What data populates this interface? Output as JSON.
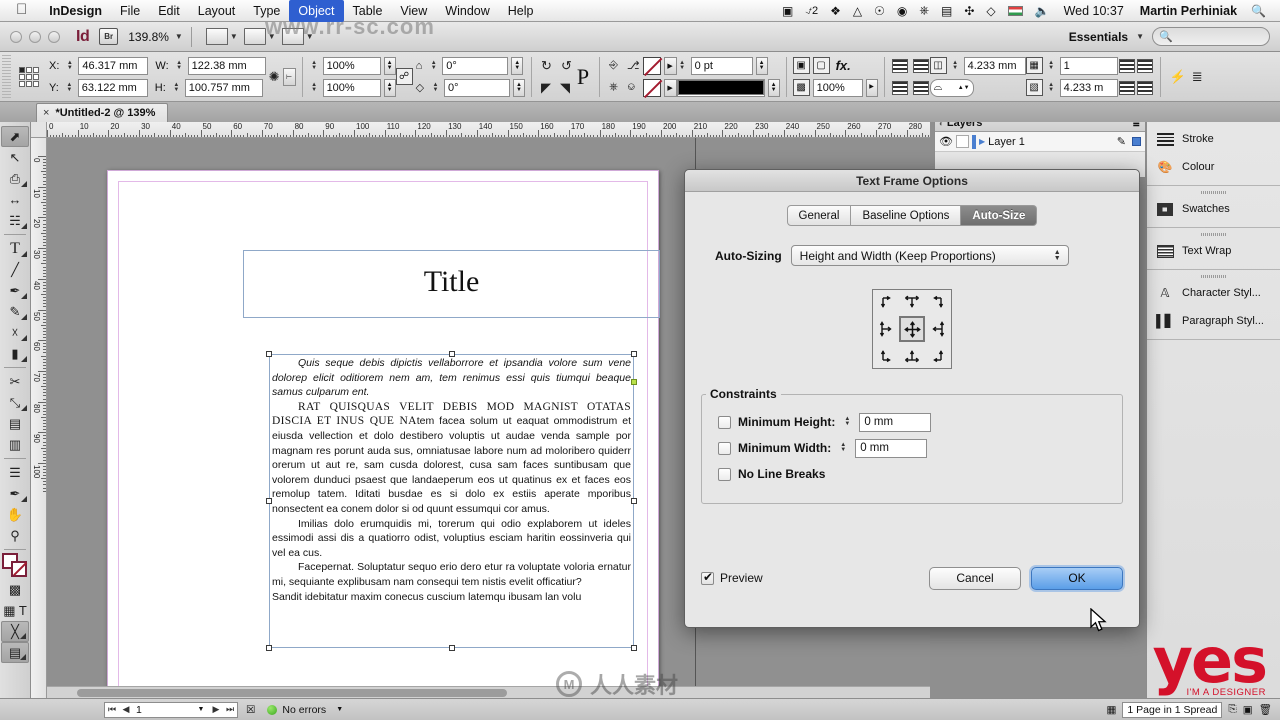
{
  "menubar": {
    "apple_icon": "apple-icon",
    "items": [
      "InDesign",
      "File",
      "Edit",
      "Layout",
      "Type",
      "Object",
      "Table",
      "View",
      "Window",
      "Help"
    ],
    "selected_item": "Object",
    "status_icons": [
      "screen-record-icon",
      "text-expander-icon",
      "dropbox-icon",
      "google-drive-icon",
      "backup-icon",
      "cloud-sync-icon",
      "system-monitor-icon",
      "display-icon",
      "spaces-icon",
      "wifi-icon",
      "flag-icon",
      "volume-icon"
    ],
    "text_expander_count": "2",
    "clock": "Wed 10:37",
    "user": "Martin Perhiniak",
    "search_icon": "spotlight-search-icon"
  },
  "apptitle": {
    "app_logo": "indesign-logo",
    "bridge_label": "Br",
    "zoom_level": "139.8%",
    "workspace": "Essentials",
    "search_placeholder": ""
  },
  "controlbar": {
    "x_label": "X:",
    "x_value": "46.317 mm",
    "y_label": "Y:",
    "y_value": "63.122 mm",
    "w_label": "W:",
    "w_value": "122.38 mm",
    "h_label": "H:",
    "h_value": "100.757 mm",
    "scale_x": "100%",
    "scale_y": "100%",
    "rotation": "0°",
    "shear": "0°",
    "stroke_weight": "0 pt",
    "stroke_type_value": "",
    "opacity": "100%",
    "inset": "4.233 mm",
    "columns": "1",
    "gutter": "4.233 m"
  },
  "tabbar": {
    "document_tab": "*Untitled-2 @ 139%",
    "close_icon": "×"
  },
  "toolbox": {
    "tools": [
      {
        "name": "selection-tool",
        "glyph": "⬈",
        "active": true,
        "flyout": false
      },
      {
        "name": "direct-selection-tool",
        "glyph": "↖",
        "active": false,
        "flyout": false
      },
      {
        "name": "page-tool",
        "glyph": "⬚",
        "active": false,
        "flyout": true
      },
      {
        "name": "gap-tool",
        "glyph": "↔",
        "active": false,
        "flyout": false
      },
      {
        "name": "content-collector-tool",
        "glyph": "☷",
        "active": false,
        "flyout": true
      },
      {
        "name": "type-tool",
        "glyph": "T",
        "active": false,
        "flyout": true
      },
      {
        "name": "line-tool",
        "glyph": "╱",
        "active": false,
        "flyout": false
      },
      {
        "name": "pen-tool",
        "glyph": "✒",
        "active": false,
        "flyout": true
      },
      {
        "name": "pencil-tool",
        "glyph": "✎",
        "active": false,
        "flyout": true
      },
      {
        "name": "frame-tool",
        "glyph": "⌧",
        "active": false,
        "flyout": true
      },
      {
        "name": "rectangle-tool",
        "glyph": "■",
        "active": false,
        "flyout": true
      },
      {
        "name": "scissors-tool",
        "glyph": "✂",
        "active": false,
        "flyout": false
      },
      {
        "name": "free-transform-tool",
        "glyph": "⤡",
        "active": false,
        "flyout": true
      },
      {
        "name": "gradient-swatch-tool",
        "glyph": "▤",
        "active": false,
        "flyout": false
      },
      {
        "name": "gradient-feather-tool",
        "glyph": "▥",
        "active": false,
        "flyout": false
      },
      {
        "name": "note-tool",
        "glyph": "☰",
        "active": false,
        "flyout": false
      },
      {
        "name": "eyedropper-tool",
        "glyph": "☂",
        "active": false,
        "flyout": true
      },
      {
        "name": "hand-tool",
        "glyph": "✋",
        "active": false,
        "flyout": false
      },
      {
        "name": "zoom-tool",
        "glyph": "⚲",
        "active": false,
        "flyout": false
      }
    ],
    "fill_stroke_name": "fill-stroke-swatches",
    "formatting_affects_container": "formatting-affects-container-icon",
    "formatting_affects_text": "formatting-affects-text-icon",
    "apply_none_name": "apply-none-icon",
    "screen_mode_name": "screen-mode-icon"
  },
  "rulers": {
    "h_labels": [
      "0",
      "10",
      "20",
      "30",
      "40",
      "50",
      "60",
      "70",
      "80",
      "90",
      "100",
      "110",
      "120",
      "130",
      "140",
      "150",
      "160",
      "170",
      "180",
      "190",
      "200",
      "210",
      "220",
      "230",
      "240",
      "250",
      "260",
      "270",
      "280"
    ],
    "v_labels": [
      "0",
      "10",
      "20",
      "30",
      "40",
      "50",
      "60",
      "70",
      "80",
      "90",
      "100"
    ]
  },
  "document": {
    "title_frame_text": "Title",
    "paragraphs": [
      {
        "style": "italic-indent",
        "text": "Quis seque debis dipictis vellaborrore et ipsandia volore sum vene dolorep elicit oditiorem nem am, tem renimus essi quis tiumqui beaque samus culparum ent."
      },
      {
        "style": "smallcaps-lead",
        "lead": "RAT QUISQUAS VELIT DEBIS MOD MAGNIST OTATAS DISCIA ET INUS QUE NA",
        "text": "tem facea solum ut eaquat ommodistrum et eiusda vellection et dolo destibero voluptis ut audae venda sample por magnam res porunt auda sus, omniatusae labore num ad moloribero quiderr orerum ut aut re, sam cusda dolorest, cusa sam faces suntibusam que volorem dunduci psaest que landaeperum eos ut quatinus ex et faces eos remolup tatem. Iditati busdae es si dolo ex estiis aperate mporibus nonsectent ea conem dolor si od quunt essumqui cor amus."
      },
      {
        "style": "indent",
        "text": "Imilias dolo erumquidis mi, torerum qui odio explaborem ut ideles essimodi assi dis a quatiorro odist, voluptius esciam haritin eossinveria qui vel ea cus."
      },
      {
        "style": "indent",
        "text": "Facepernat. Soluptatur sequo erio dero etur ra voluptate voloria ernatur mi, sequiante explibusam nam consequi tem nistis evelit officatiur?"
      },
      {
        "style": "plain",
        "text": "Sandit idebitatur maxim conecus cuscium latemqu ibusam lan volu"
      }
    ]
  },
  "layers_panel": {
    "title": "Layers",
    "menu_icon": "panel-menu-icon",
    "rows": [
      {
        "name": "Layer 1",
        "visible_icon": "eye-icon",
        "lock_icon": "lock-cell",
        "selected": true
      }
    ]
  },
  "right_dock": {
    "groups": [
      {
        "items": [
          {
            "label": "Stroke",
            "icon": "stroke-icon"
          },
          {
            "label": "Colour",
            "icon": "colour-palette-icon"
          }
        ]
      },
      {
        "items": [
          {
            "label": "Swatches",
            "icon": "swatches-icon"
          }
        ]
      },
      {
        "items": [
          {
            "label": "Text Wrap",
            "icon": "text-wrap-icon"
          }
        ]
      },
      {
        "items": [
          {
            "label": "Character Styl...",
            "icon": "character-styles-icon"
          },
          {
            "label": "Paragraph Styl...",
            "icon": "paragraph-styles-icon"
          }
        ]
      }
    ]
  },
  "dialog": {
    "title": "Text Frame Options",
    "tabs": [
      "General",
      "Baseline Options",
      "Auto-Size"
    ],
    "active_tab": "Auto-Size",
    "autosizing_label": "Auto-Sizing",
    "autosizing_value": "Height and Width (Keep Proportions)",
    "anchor_grid_name": "auto-size-reference-point-grid",
    "anchor_selected_index": 4,
    "constraints_legend": "Constraints",
    "constraints": [
      {
        "label": "Minimum Height:",
        "checked": false,
        "value": "0 mm",
        "has_field": true
      },
      {
        "label": "Minimum Width:",
        "checked": false,
        "value": "0 mm",
        "has_field": true
      },
      {
        "label": "No Line Breaks",
        "checked": false,
        "value": "",
        "has_field": false
      }
    ],
    "preview_label": "Preview",
    "preview_checked": true,
    "cancel_label": "Cancel",
    "ok_label": "OK"
  },
  "statusbar": {
    "page_number": "1",
    "error_status": "No errors",
    "spread_info": "1 Page in 1 Spread"
  },
  "watermarks": {
    "top": "www.rr-sc.com",
    "center": "人人素材",
    "yes_main": "yes",
    "yes_sub": "I'M A DESIGNER"
  },
  "colors": {
    "accent_blue": "#2f5fd0",
    "indesign_brand": "#7b1f3a",
    "ok_button": "#5b9ee8",
    "error_green": "#3aa81f",
    "yes_red": "#d4112a"
  }
}
